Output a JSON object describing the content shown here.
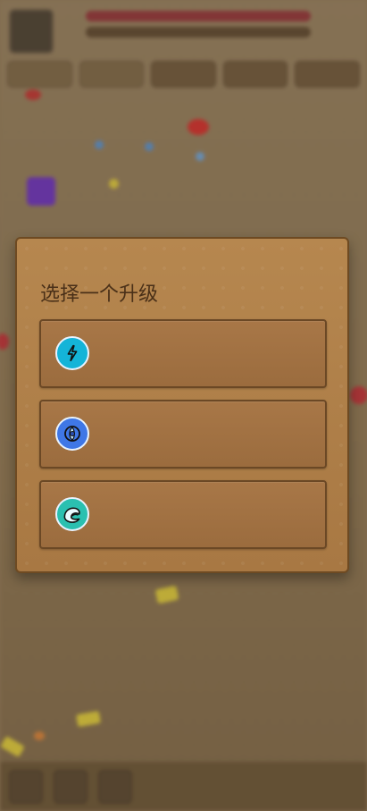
{
  "modal": {
    "title": "选择一个升级",
    "options": [
      {
        "icon": "lightning-icon",
        "label": "",
        "color": "#14b4d8"
      },
      {
        "icon": "orbit-icon",
        "label": "",
        "color": "#3f77e6"
      },
      {
        "icon": "shield-wave-icon",
        "label": "",
        "color": "#2ac0b0"
      }
    ]
  },
  "colors": {
    "panel": "#b07f47",
    "panel_border": "#6e4a22",
    "option_border": "#6b4825",
    "title_text": "#4a3018"
  }
}
